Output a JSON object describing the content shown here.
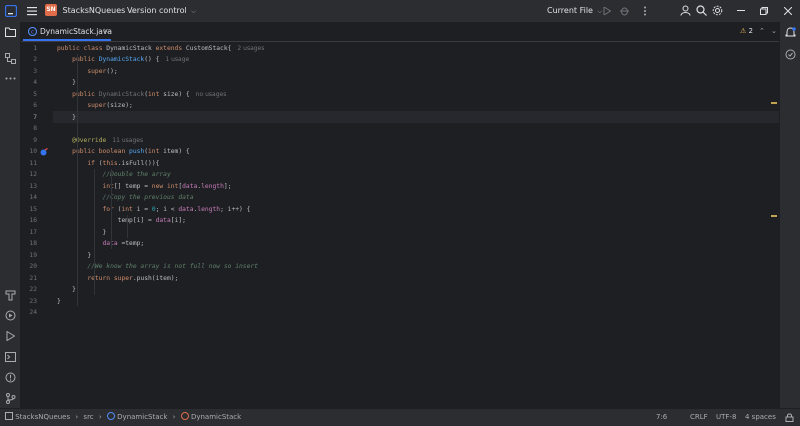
{
  "title_bar": {
    "project_badge": "SN",
    "project_name": "StacksNQueues",
    "vcs_label": "Version control",
    "run_config": "Current File"
  },
  "tab": {
    "label": "DynamicStack.java"
  },
  "inspection": {
    "warnings": "2"
  },
  "editor": {
    "current_line": 7,
    "lines": [
      {
        "n": "1",
        "html": "<span class=\"kw\">public class</span> DynamicStack <span class=\"kw\">extends</span> CustomStack{<span class=\"hint\">2 usages</span>"
      },
      {
        "n": "2",
        "html": "    <span class=\"kw\">public</span> <span class=\"fn\">DynamicStack</span>() {<span class=\"hint\">1 usage</span>"
      },
      {
        "n": "3",
        "html": "        <span class=\"kw\">super</span>();"
      },
      {
        "n": "4",
        "html": "    }"
      },
      {
        "n": "5",
        "html": "    <span class=\"kw\">public</span> <span class=\"unused\">DynamicStack</span>(<span class=\"kw\">int</span> size) {<span class=\"hint\">no usages</span>"
      },
      {
        "n": "6",
        "html": "        <span class=\"kw\">super</span>(size);"
      },
      {
        "n": "7",
        "html": "    }"
      },
      {
        "n": "8",
        "html": ""
      },
      {
        "n": "9",
        "html": "    <span class=\"ann\">@Override</span><span class=\"hint\">11 usages</span>"
      },
      {
        "n": "10",
        "html": "    <span class=\"kw\">public boolean</span> <span class=\"fn\">push</span>(<span class=\"kw\">int</span> item) {"
      },
      {
        "n": "11",
        "html": "        <span class=\"kw\">if</span> (<span class=\"kw\">this</span>.isFull()){"
      },
      {
        "n": "12",
        "html": "            <span class=\"cmg\">//Double the array</span>"
      },
      {
        "n": "13",
        "html": "            <span class=\"kw\">int</span>[] temp = <span class=\"kw\">new int</span>[<span class=\"fld\">data</span>.<span class=\"fld\">length</span>];"
      },
      {
        "n": "14",
        "html": "            <span class=\"cmg\">//Copy the previous data</span>"
      },
      {
        "n": "15",
        "html": "            <span class=\"kw\">for</span> (<span class=\"kw\">int</span> i = <span class=\"num\">0</span>; i &lt; <span class=\"fld\">data</span>.<span class=\"fld\">length</span>; i++) {"
      },
      {
        "n": "16",
        "html": "                temp[i] = <span class=\"fld\">data</span>[i];"
      },
      {
        "n": "17",
        "html": "            }"
      },
      {
        "n": "18",
        "html": "            <span class=\"fld\">data</span> =temp;"
      },
      {
        "n": "19",
        "html": "        }"
      },
      {
        "n": "20",
        "html": "        <span class=\"cmg\">//We know the array is not full now so insert</span>"
      },
      {
        "n": "21",
        "html": "        <span class=\"kw\">return super</span>.push(item);"
      },
      {
        "n": "22",
        "html": "    }"
      },
      {
        "n": "23",
        "html": "}"
      },
      {
        "n": "24",
        "html": ""
      }
    ]
  },
  "breadcrumbs": [
    "StacksNQueues",
    "src",
    "DynamicStack",
    "DynamicStack"
  ],
  "status": {
    "position": "7:6",
    "line_ending": "CRLF",
    "encoding": "UTF-8",
    "indent": "4 spaces"
  },
  "colors": {
    "accent": "#3574f0",
    "badge": "#e06c4a",
    "warning": "#f2c55c"
  },
  "icons": [
    "app-logo-icon",
    "hamburger-menu-icon",
    "run-icon",
    "debug-icon",
    "user-icon",
    "search-icon",
    "settings-icon",
    "minimize-icon",
    "restore-icon",
    "close-icon",
    "folder-icon",
    "structure-icon",
    "more-icon",
    "notifications-icon",
    "build-icon",
    "services-icon",
    "run-panel-icon",
    "terminal-icon",
    "problems-icon",
    "git-icon"
  ]
}
